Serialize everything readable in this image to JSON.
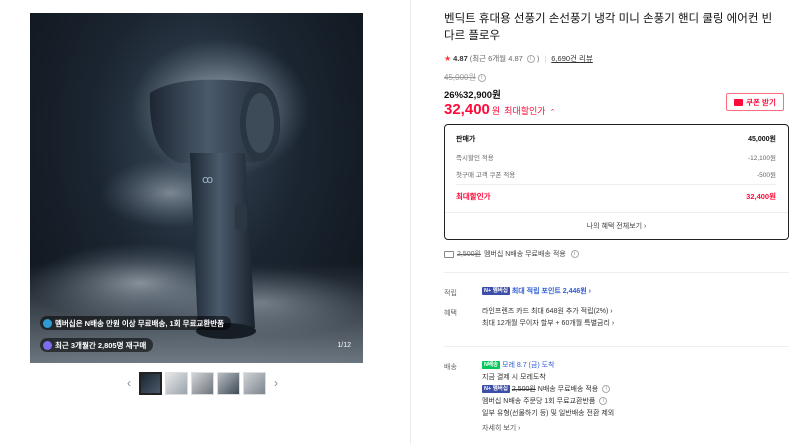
{
  "gallery": {
    "badge1": "멤버십은 N배송 만원 이상 무료배송, 1회 무료교환반품",
    "badge2": "최근 3개월간 2,805명 재구매",
    "page_indicator": "1/12",
    "prev_arrow": "‹",
    "next_arrow": "›",
    "product_mark": "ꝏ"
  },
  "product": {
    "title": "벤딕트 휴대용 선풍기 손선풍기 냉각 미니 손풍기 핸디 쿨링 에어컨 빈다르 플로우",
    "rating_star": "★",
    "rating_score": "4.87",
    "rating_recent": "(최근 6개월 4.87",
    "rating_recent_close": ")",
    "rating_info_icon": "i",
    "review_count": "6,690건 리뷰",
    "original_price": "45,000원",
    "discount": "26%32,900원",
    "max_price_amount": "32,400",
    "max_price_won": "원",
    "max_price_label": "최대할인가",
    "max_price_chevron": "⌃",
    "coupon_button": "쿠폰 받기"
  },
  "price_box": {
    "head_label": "판매가",
    "head_value": "45,000원",
    "rows": [
      {
        "label": "즉시할인 적용",
        "value": "-12,100원"
      },
      {
        "label": "첫구매 고객 쿠폰 적용",
        "value": "-500원"
      }
    ],
    "total_label": "최대할인가",
    "total_value": "32,400원",
    "benefit_link": "나의 혜택 전체보기 ›"
  },
  "shipping": {
    "strike_price": "2,500원",
    "text": "멤버십 N배송 무료배송 적용",
    "info_icon": "i"
  },
  "points": {
    "label": "적립",
    "npay_badge": "N+ 멤버십",
    "link": "최대 적립 포인트 2,446원 ›"
  },
  "benefit": {
    "label": "혜택",
    "line1": "라인프렌즈 카드 최대 648원 추가 적립(2%) ›",
    "line2": "최대 12개월 무이자 할부 + 60개월 특별금리 ›"
  },
  "delivery": {
    "label": "배송",
    "npay_badge": "N배송",
    "eta": "모레 8.7 (금) 도착",
    "line1": "지금 결제 시 모레도착",
    "npay_badge2": "N+ 멤버십",
    "strike": "2,500원",
    "line2_tail": "N배송 무료배송 적용",
    "info_icon": "i",
    "line3": "멤버십 N배송 주문당 1회 무료교환반품",
    "line3_icon": "i",
    "line4": "일부 유형(선물하기 등) 및 일반배송 전환 제외",
    "more": "자세히 보기 ›"
  },
  "colors": {
    "accent_red": "#ff0a3a",
    "npay_green": "#03c75a",
    "link_blue": "#2d5cd6"
  }
}
